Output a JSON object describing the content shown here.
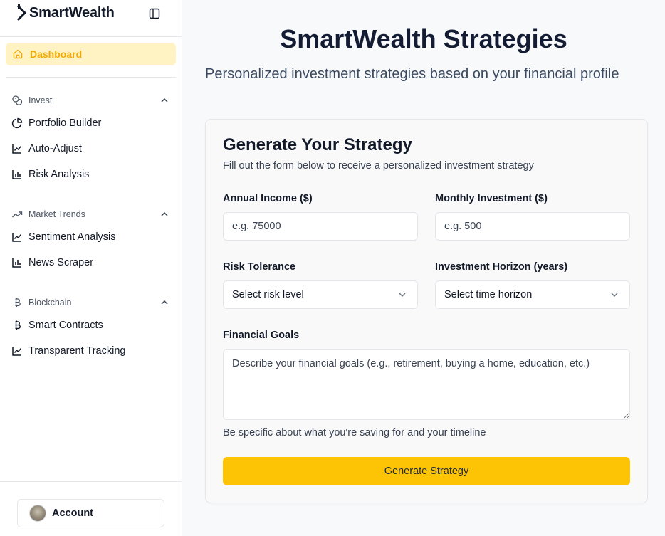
{
  "brand": {
    "name": "SmartWealth"
  },
  "sidebar": {
    "active_item": {
      "label": "Dashboard",
      "icon": "home-icon"
    },
    "groups": [
      {
        "label": "Invest",
        "icon": "coins-icon",
        "items": [
          {
            "label": "Portfolio Builder",
            "icon": "pie-chart-icon"
          },
          {
            "label": "Auto-Adjust",
            "icon": "line-chart-icon"
          },
          {
            "label": "Risk Analysis",
            "icon": "bar-chart-icon"
          }
        ]
      },
      {
        "label": "Market Trends",
        "icon": "trending-up-icon",
        "items": [
          {
            "label": "Sentiment Analysis",
            "icon": "line-chart-icon"
          },
          {
            "label": "News Scraper",
            "icon": "bar-chart-icon"
          }
        ]
      },
      {
        "label": "Blockchain",
        "icon": "bitcoin-icon",
        "items": [
          {
            "label": "Smart Contracts",
            "icon": "bitcoin-icon"
          },
          {
            "label": "Transparent Tracking",
            "icon": "line-chart-icon"
          }
        ]
      }
    ],
    "account": {
      "label": "Account"
    }
  },
  "header": {
    "title": "SmartWealth Strategies",
    "subtitle": "Personalized investment strategies based on your financial profile"
  },
  "form": {
    "title": "Generate Your Strategy",
    "description": "Fill out the form below to receive a personalized investment strategy",
    "annual_income": {
      "label": "Annual Income ($)",
      "placeholder": "e.g. 75000",
      "value": ""
    },
    "monthly_investment": {
      "label": "Monthly Investment ($)",
      "placeholder": "e.g. 500",
      "value": ""
    },
    "risk_tolerance": {
      "label": "Risk Tolerance",
      "selected": "Select risk level"
    },
    "investment_horizon": {
      "label": "Investment Horizon (years)",
      "selected": "Select time horizon"
    },
    "financial_goals": {
      "label": "Financial Goals",
      "placeholder": "Describe your financial goals (e.g., retirement, buying a home, education, etc.)",
      "hint": "Be specific about what you're saving for and your timeline"
    },
    "submit_label": "Generate Strategy"
  },
  "colors": {
    "accent": "#fdc305",
    "active_text": "#f2a900",
    "active_bg": "#fff3c4"
  }
}
